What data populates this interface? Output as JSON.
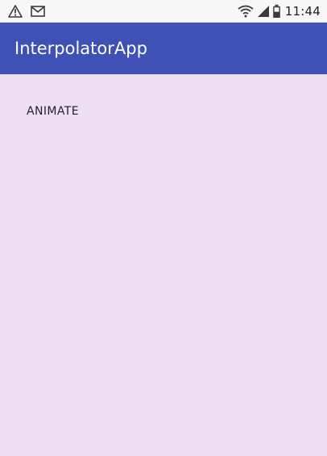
{
  "status_bar": {
    "left_icons": [
      "warning-icon",
      "mail-icon"
    ],
    "right_icons": [
      "wifi-icon",
      "signal-icon",
      "battery-icon"
    ],
    "time": "11:44"
  },
  "app_bar": {
    "title": "InterpolatorApp",
    "background_color": "#3F51B5",
    "title_color": "#FFFFFF"
  },
  "main": {
    "background_color": "#EDE0F2",
    "animate_button_label": "ANIMATE"
  }
}
